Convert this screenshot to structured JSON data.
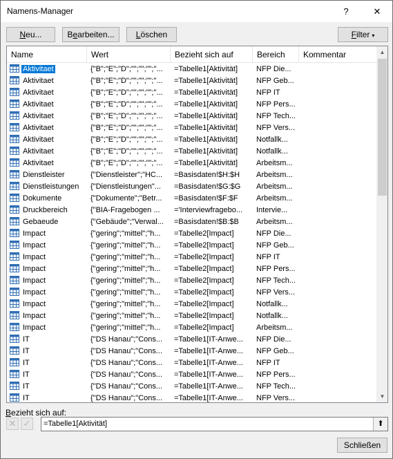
{
  "window": {
    "title": "Namens-Manager",
    "help_label": "?",
    "close_label": "✕"
  },
  "toolbar": {
    "new_label_u": "N",
    "new_label_rest": "eu...",
    "edit_label_pre": "B",
    "edit_label_u": "e",
    "edit_label_rest": "arbeiten...",
    "delete_label_u": "L",
    "delete_label_rest": "öschen",
    "filter_label_u": "F",
    "filter_label_rest": "ilter",
    "filter_caret": "▾"
  },
  "columns": [
    "Name",
    "Wert",
    "Bezieht sich auf",
    "Bereich",
    "Kommentar"
  ],
  "rows": [
    {
      "name": "Aktivitaet",
      "value": "{\"B\";\"E\";\"D\";\"\";\"\";\"\";\"...",
      "ref": "=Tabelle1[Aktivität]",
      "scope": "NFP Die...",
      "comment": "",
      "selected": true
    },
    {
      "name": "Aktivitaet",
      "value": "{\"B\";\"E\";\"D\";\"\";\"\";\"\";\"...",
      "ref": "=Tabelle1[Aktivität]",
      "scope": "NFP Geb...",
      "comment": ""
    },
    {
      "name": "Aktivitaet",
      "value": "{\"B\";\"E\";\"D\";\"\";\"\";\"\";\"...",
      "ref": "=Tabelle1[Aktivität]",
      "scope": "NFP IT",
      "comment": ""
    },
    {
      "name": "Aktivitaet",
      "value": "{\"B\";\"E\";\"D\";\"\";\"\";\"\";\"...",
      "ref": "=Tabelle1[Aktivität]",
      "scope": "NFP Pers...",
      "comment": ""
    },
    {
      "name": "Aktivitaet",
      "value": "{\"B\";\"E\";\"D\";\"\";\"\";\"\";\"...",
      "ref": "=Tabelle1[Aktivität]",
      "scope": "NFP Tech...",
      "comment": ""
    },
    {
      "name": "Aktivitaet",
      "value": "{\"B\";\"E\";\"D\";\"\";\"\";\"\";\"...",
      "ref": "=Tabelle1[Aktivität]",
      "scope": "NFP Vers...",
      "comment": ""
    },
    {
      "name": "Aktivitaet",
      "value": "{\"B\";\"E\";\"D\";\"\";\"\";\"\";\"...",
      "ref": "=Tabelle1[Aktivität]",
      "scope": "Notfallk...",
      "comment": ""
    },
    {
      "name": "Aktivitaet",
      "value": "{\"B\";\"E\";\"D\";\"\";\"\";\"\";\"...",
      "ref": "=Tabelle1[Aktivität]",
      "scope": "Notfallk...",
      "comment": ""
    },
    {
      "name": "Aktivitaet",
      "value": "{\"B\";\"E\";\"D\";\"\";\"\";\"\";\"...",
      "ref": "=Tabelle1[Aktivität]",
      "scope": "Arbeitsm...",
      "comment": ""
    },
    {
      "name": "Dienstleister",
      "value": "{\"Dienstleister\";\"HC...",
      "ref": "=Basisdaten!$H:$H",
      "scope": "Arbeitsm...",
      "comment": ""
    },
    {
      "name": "Dienstleistungen",
      "value": "{\"Dienstleistungen\"...",
      "ref": "=Basisdaten!$G:$G",
      "scope": "Arbeitsm...",
      "comment": ""
    },
    {
      "name": "Dokumente",
      "value": "{\"Dokumente\";\"Betr...",
      "ref": "=Basisdaten!$F:$F",
      "scope": "Arbeitsm...",
      "comment": ""
    },
    {
      "name": "Druckbereich",
      "value": "{\"BIA-Fragebogen ...",
      "ref": "='Interviewfragebo...",
      "scope": "Intervie...",
      "comment": ""
    },
    {
      "name": "Gebaeude",
      "value": "{\"Gebäude\";\"Verwal...",
      "ref": "=Basisdaten!$B:$B",
      "scope": "Arbeitsm...",
      "comment": ""
    },
    {
      "name": "Impact",
      "value": "{\"gering\";\"mittel\";\"h...",
      "ref": "=Tabelle2[Impact]",
      "scope": "NFP Die...",
      "comment": ""
    },
    {
      "name": "Impact",
      "value": "{\"gering\";\"mittel\";\"h...",
      "ref": "=Tabelle2[Impact]",
      "scope": "NFP Geb...",
      "comment": ""
    },
    {
      "name": "Impact",
      "value": "{\"gering\";\"mittel\";\"h...",
      "ref": "=Tabelle2[Impact]",
      "scope": "NFP IT",
      "comment": ""
    },
    {
      "name": "Impact",
      "value": "{\"gering\";\"mittel\";\"h...",
      "ref": "=Tabelle2[Impact]",
      "scope": "NFP Pers...",
      "comment": ""
    },
    {
      "name": "Impact",
      "value": "{\"gering\";\"mittel\";\"h...",
      "ref": "=Tabelle2[Impact]",
      "scope": "NFP Tech...",
      "comment": ""
    },
    {
      "name": "Impact",
      "value": "{\"gering\";\"mittel\";\"h...",
      "ref": "=Tabelle2[Impact]",
      "scope": "NFP Vers...",
      "comment": ""
    },
    {
      "name": "Impact",
      "value": "{\"gering\";\"mittel\";\"h...",
      "ref": "=Tabelle2[Impact]",
      "scope": "Notfallk...",
      "comment": ""
    },
    {
      "name": "Impact",
      "value": "{\"gering\";\"mittel\";\"h...",
      "ref": "=Tabelle2[Impact]",
      "scope": "Notfallk...",
      "comment": ""
    },
    {
      "name": "Impact",
      "value": "{\"gering\";\"mittel\";\"h...",
      "ref": "=Tabelle2[Impact]",
      "scope": "Arbeitsm...",
      "comment": ""
    },
    {
      "name": "IT",
      "value": "{\"DS Hanau\";\"Cons...",
      "ref": "=Tabelle1[IT-Anwe...",
      "scope": "NFP Die...",
      "comment": ""
    },
    {
      "name": "IT",
      "value": "{\"DS Hanau\";\"Cons...",
      "ref": "=Tabelle1[IT-Anwe...",
      "scope": "NFP Geb...",
      "comment": ""
    },
    {
      "name": "IT",
      "value": "{\"DS Hanau\";\"Cons...",
      "ref": "=Tabelle1[IT-Anwe...",
      "scope": "NFP IT",
      "comment": ""
    },
    {
      "name": "IT",
      "value": "{\"DS Hanau\";\"Cons...",
      "ref": "=Tabelle1[IT-Anwe...",
      "scope": "NFP Pers...",
      "comment": ""
    },
    {
      "name": "IT",
      "value": "{\"DS Hanau\";\"Cons...",
      "ref": "=Tabelle1[IT-Anwe...",
      "scope": "NFP Tech...",
      "comment": ""
    },
    {
      "name": "IT",
      "value": "{\"DS Hanau\";\"Cons...",
      "ref": "=Tabelle1[IT-Anwe...",
      "scope": "NFP Vers...",
      "comment": ""
    }
  ],
  "refers_to": {
    "label_u": "B",
    "label_rest": "ezieht sich auf:",
    "value": "=Tabelle1[Aktivität]",
    "cancel_icon": "✕",
    "ok_icon": "✓",
    "collapse_icon": "⬆"
  },
  "footer": {
    "close_label": "Schließen"
  },
  "colors": {
    "selection": "#0078d7",
    "icon_blue": "#2f6eb5"
  }
}
